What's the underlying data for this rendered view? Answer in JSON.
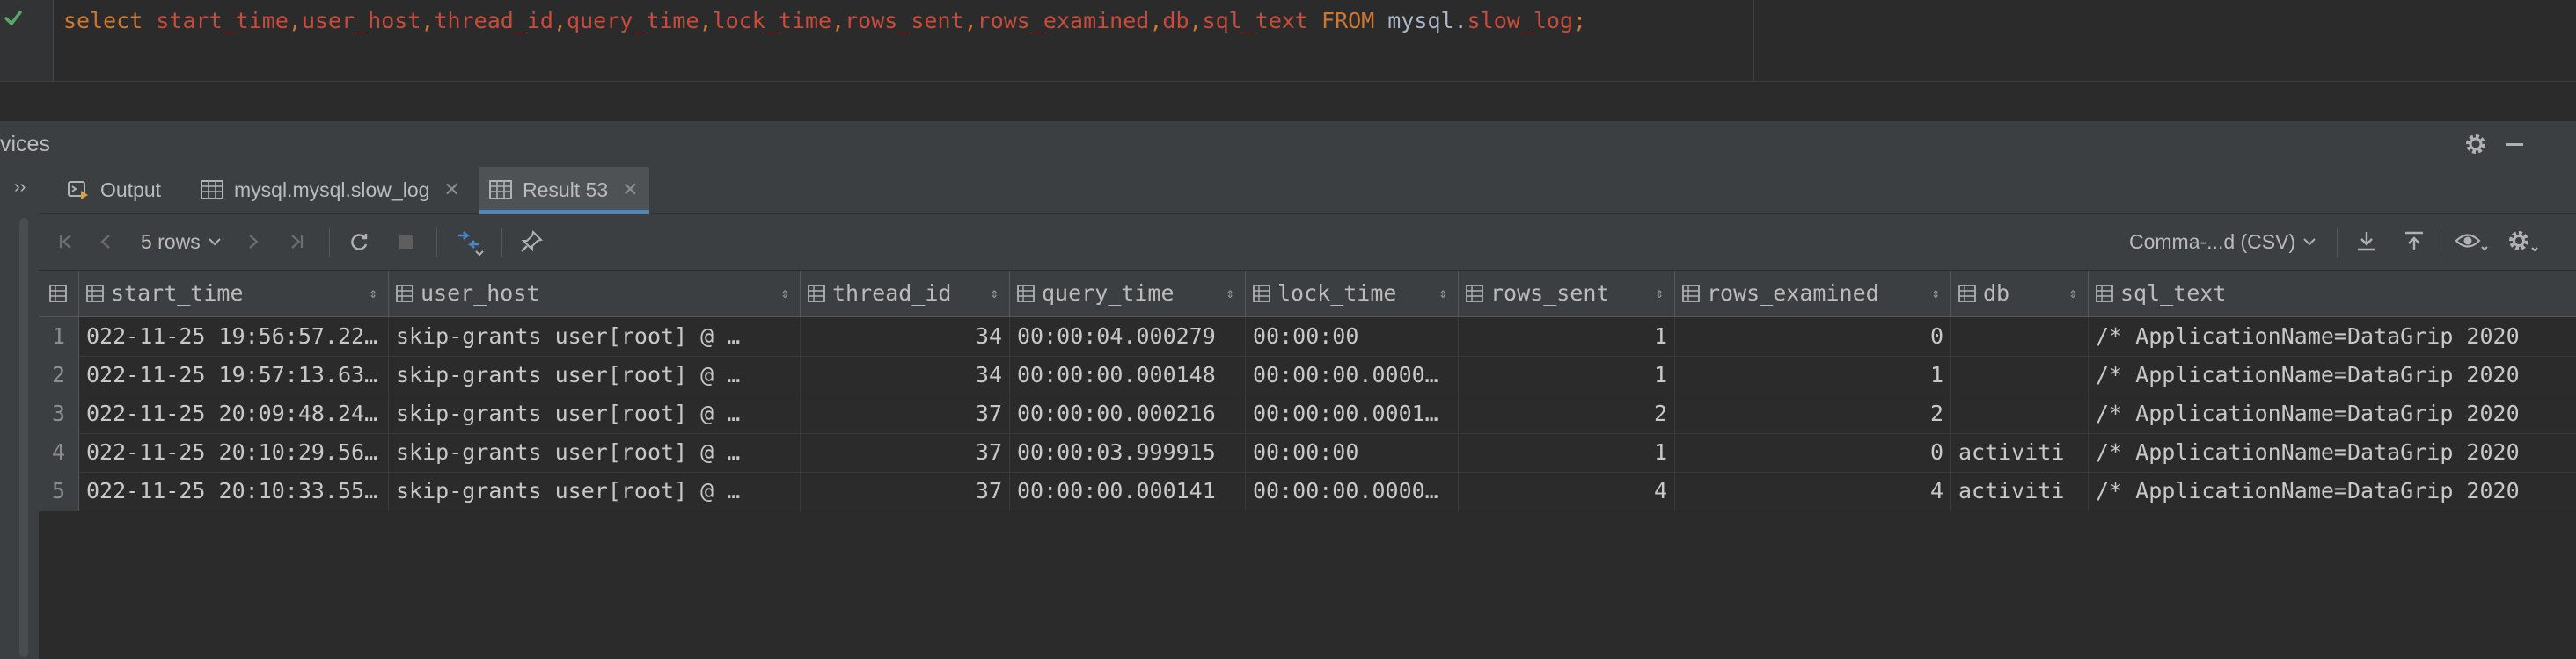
{
  "editor": {
    "status_icon": "check-icon",
    "tokens": [
      {
        "t": "select",
        "c": "kw"
      },
      {
        "t": " ",
        "c": "plain"
      },
      {
        "t": "start_time",
        "c": "fld"
      },
      {
        "t": ",",
        "c": "kw"
      },
      {
        "t": "user_host",
        "c": "fld"
      },
      {
        "t": ",",
        "c": "kw"
      },
      {
        "t": "thread_id",
        "c": "fld"
      },
      {
        "t": ",",
        "c": "kw"
      },
      {
        "t": "query_time",
        "c": "fld"
      },
      {
        "t": ",",
        "c": "kw"
      },
      {
        "t": "lock_time",
        "c": "fld"
      },
      {
        "t": ",",
        "c": "kw"
      },
      {
        "t": "rows_sent",
        "c": "fld"
      },
      {
        "t": ",",
        "c": "kw"
      },
      {
        "t": "rows_examined",
        "c": "fld"
      },
      {
        "t": ",",
        "c": "kw"
      },
      {
        "t": "db",
        "c": "fld"
      },
      {
        "t": ",",
        "c": "kw"
      },
      {
        "t": "sql_text",
        "c": "fld"
      },
      {
        "t": " FROM ",
        "c": "kw"
      },
      {
        "t": "mysql",
        "c": "plain"
      },
      {
        "t": ".",
        "c": "plain"
      },
      {
        "t": "slow_log",
        "c": "fld"
      },
      {
        "t": ";",
        "c": "kw"
      }
    ]
  },
  "services": {
    "title": "vices"
  },
  "tabs": [
    {
      "label": "Output",
      "icon": "output-icon",
      "closable": false
    },
    {
      "label": "mysql.mysql.slow_log",
      "icon": "table-icon",
      "closable": true
    },
    {
      "label": "Result 53",
      "icon": "table-icon",
      "closable": true,
      "active": true
    }
  ],
  "toolbar": {
    "rows_label": "5 rows",
    "format_label": "Comma-...d (CSV)"
  },
  "grid": {
    "columns": [
      "start_time",
      "user_host",
      "thread_id",
      "query_time",
      "lock_time",
      "rows_sent",
      "rows_examined",
      "db",
      "sql_text"
    ],
    "rows": [
      {
        "n": "1",
        "cells": [
          "022-11-25 19:56:57.22…",
          "skip-grants user[root] @ …",
          "34",
          "00:00:04.000279",
          "00:00:00",
          "1",
          "0",
          "",
          "/* ApplicationName=DataGrip 2020"
        ]
      },
      {
        "n": "2",
        "cells": [
          "022-11-25 19:57:13.63…",
          "skip-grants user[root] @ …",
          "34",
          "00:00:00.000148",
          "00:00:00.0000…",
          "1",
          "1",
          "",
          "/* ApplicationName=DataGrip 2020"
        ]
      },
      {
        "n": "3",
        "cells": [
          "022-11-25 20:09:48.24…",
          "skip-grants user[root] @ …",
          "37",
          "00:00:00.000216",
          "00:00:00.0001…",
          "2",
          "2",
          "",
          "/* ApplicationName=DataGrip 2020"
        ]
      },
      {
        "n": "4",
        "cells": [
          "022-11-25 20:10:29.56…",
          "skip-grants user[root] @ …",
          "37",
          "00:00:03.999915",
          "00:00:00",
          "1",
          "0",
          "activiti",
          "/* ApplicationName=DataGrip 2020"
        ]
      },
      {
        "n": "5",
        "cells": [
          "022-11-25 20:10:33.55…",
          "skip-grants user[root] @ …",
          "37",
          "00:00:00.000141",
          "00:00:00.0000…",
          "4",
          "4",
          "activiti",
          "/* ApplicationName=DataGrip 2020"
        ]
      }
    ]
  },
  "colors": {
    "keyword": "#cc7832",
    "field": "#c84b3c",
    "accent": "#4a88c7",
    "check": "#59a869"
  }
}
